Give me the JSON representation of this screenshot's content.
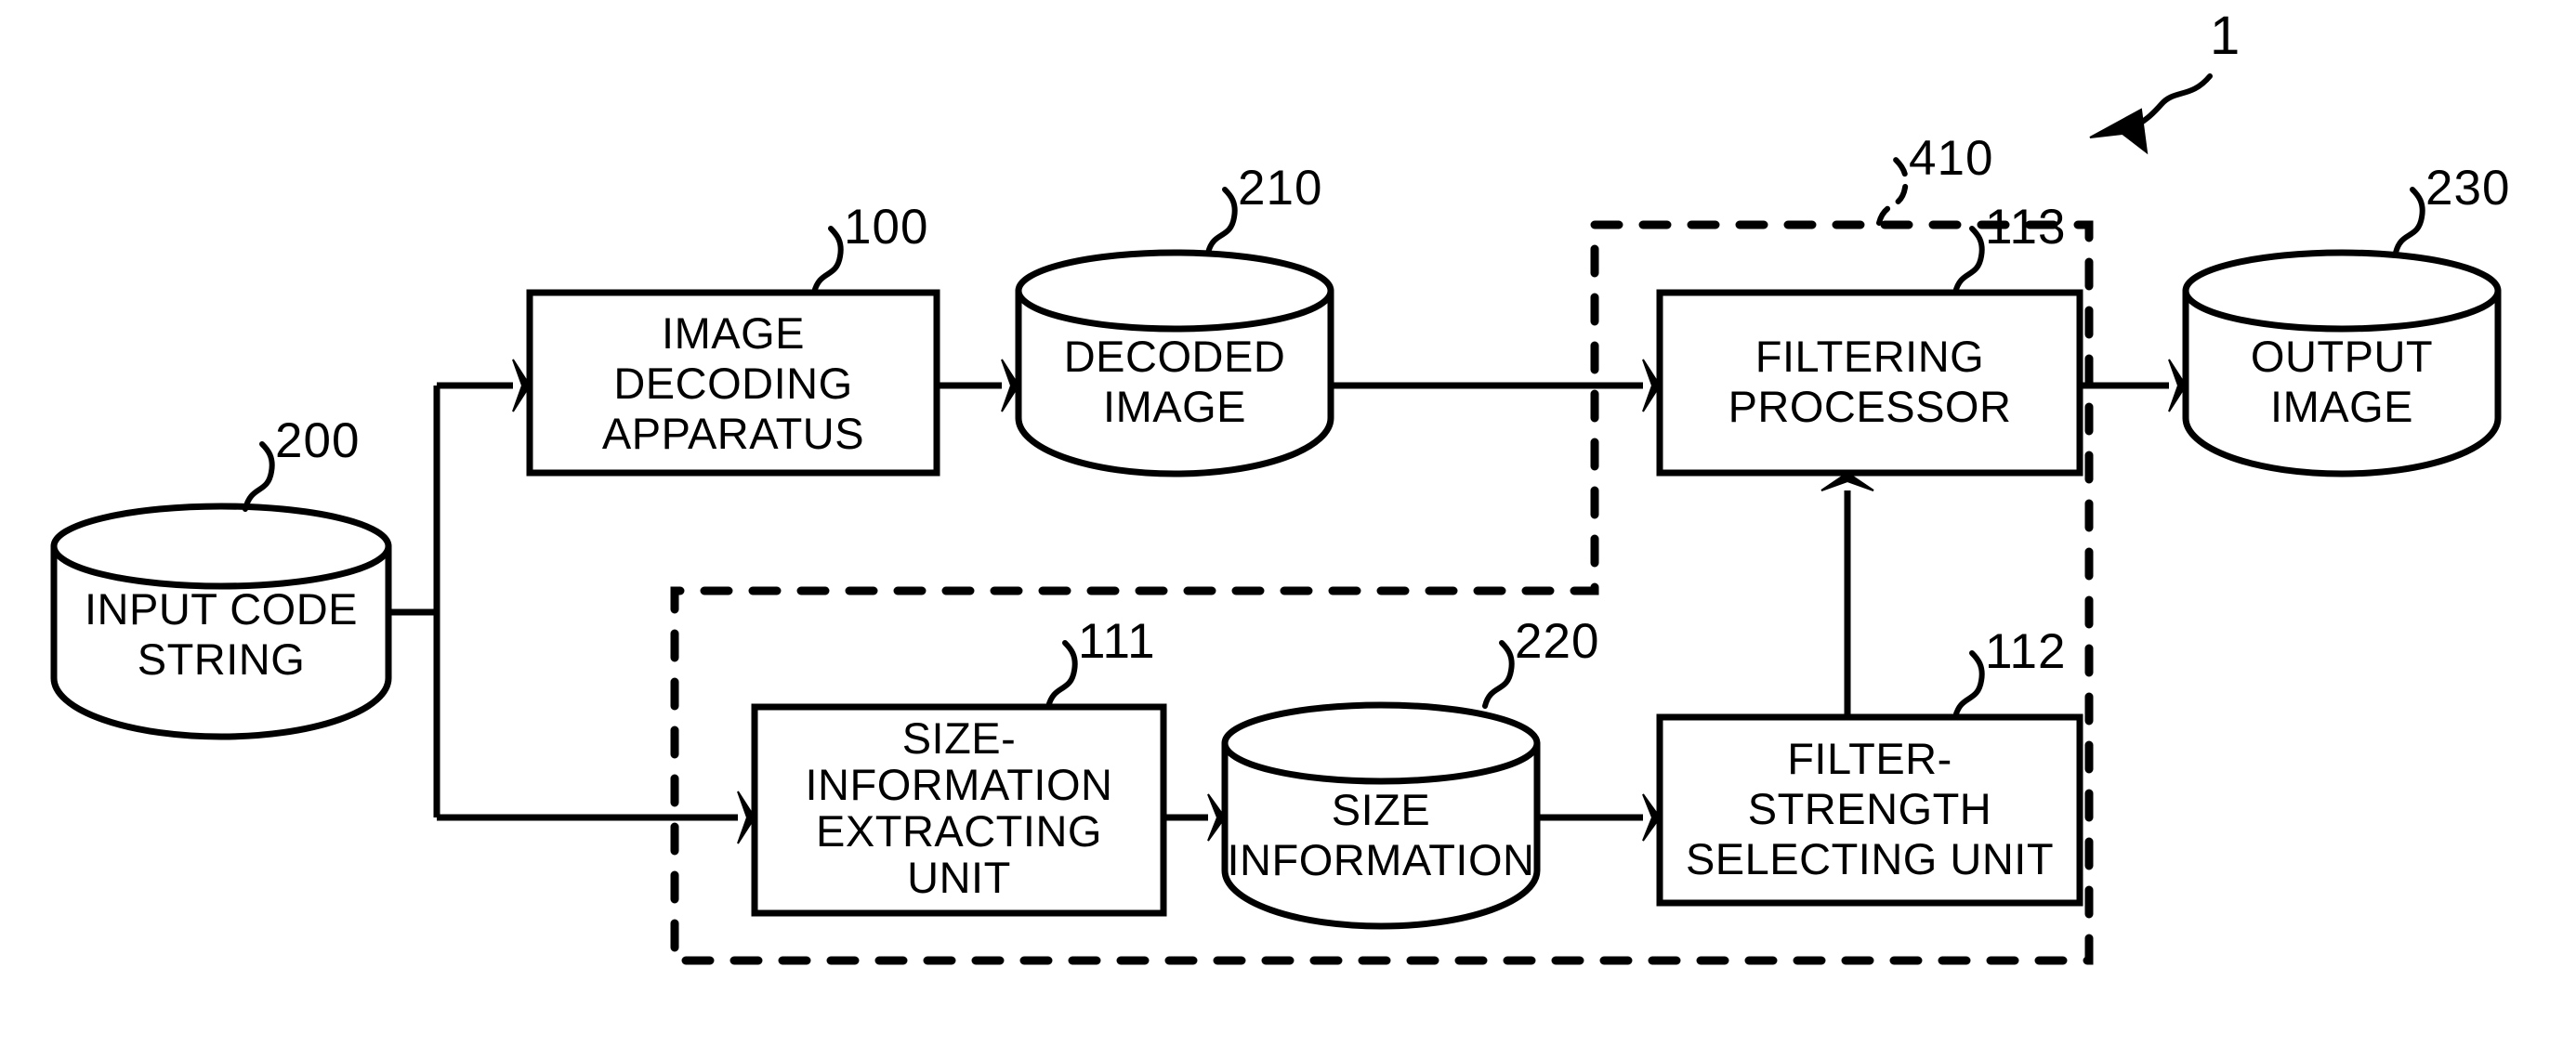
{
  "figure": {
    "overall_ref": "1",
    "diagram_type": "block-diagram",
    "background_color": "#ffffff",
    "line_color": "#000000"
  },
  "group": {
    "ref": "410",
    "style": "dashed",
    "contains": [
      "113",
      "111",
      "112",
      "220"
    ]
  },
  "nodes": {
    "input_code_string": {
      "ref": "200",
      "shape": "cylinder",
      "lines": [
        "INPUT CODE",
        "STRING"
      ]
    },
    "image_decoding_apparatus": {
      "ref": "100",
      "shape": "rectangle",
      "lines": [
        "IMAGE",
        "DECODING",
        "APPARATUS"
      ]
    },
    "decoded_image": {
      "ref": "210",
      "shape": "cylinder",
      "lines": [
        "DECODED",
        "IMAGE"
      ]
    },
    "filtering_processor": {
      "ref": "113",
      "shape": "rectangle",
      "lines": [
        "FILTERING",
        "PROCESSOR"
      ]
    },
    "output_image": {
      "ref": "230",
      "shape": "cylinder",
      "lines": [
        "OUTPUT",
        "IMAGE"
      ]
    },
    "size_information_extracting_unit": {
      "ref": "111",
      "shape": "rectangle",
      "lines": [
        "SIZE-",
        "INFORMATION",
        "EXTRACTING",
        "UNIT"
      ]
    },
    "size_information": {
      "ref": "220",
      "shape": "cylinder",
      "lines": [
        "SIZE",
        "INFORMATION"
      ]
    },
    "filter_strength_selecting_unit": {
      "ref": "112",
      "shape": "rectangle",
      "lines": [
        "FILTER-",
        "STRENGTH",
        "SELECTING UNIT"
      ]
    }
  },
  "connections": [
    {
      "from": "input_code_string",
      "to": "image_decoding_apparatus"
    },
    {
      "from": "image_decoding_apparatus",
      "to": "decoded_image"
    },
    {
      "from": "decoded_image",
      "to": "filtering_processor"
    },
    {
      "from": "filtering_processor",
      "to": "output_image"
    },
    {
      "from": "input_code_string",
      "to": "size_information_extracting_unit"
    },
    {
      "from": "size_information_extracting_unit",
      "to": "size_information"
    },
    {
      "from": "size_information",
      "to": "filter_strength_selecting_unit"
    },
    {
      "from": "filter_strength_selecting_unit",
      "to": "filtering_processor"
    }
  ]
}
